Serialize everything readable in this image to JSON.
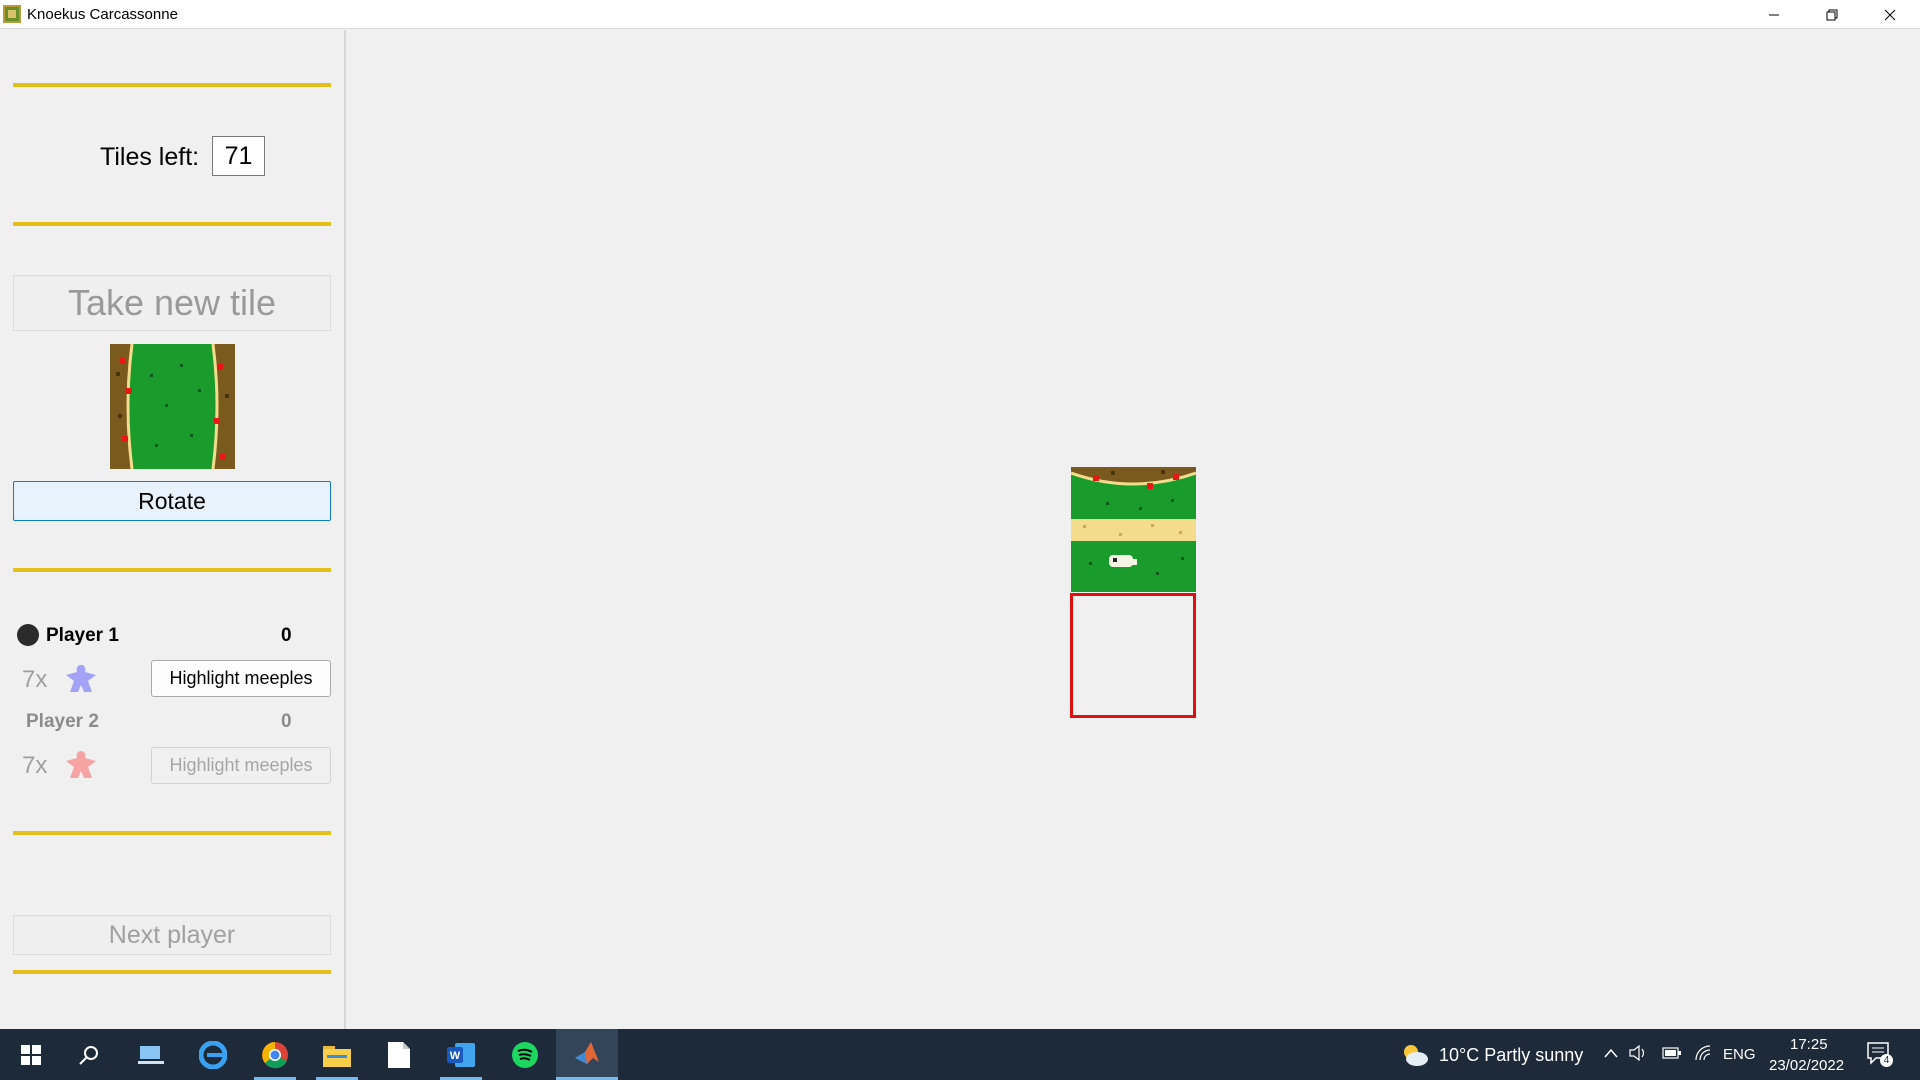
{
  "window": {
    "title": "Knoekus Carcassonne"
  },
  "sidebar": {
    "tiles_left_label": "Tiles left:",
    "tiles_left_value": "71",
    "take_tile_label": "Take new tile",
    "rotate_label": "Rotate",
    "next_player_label": "Next player",
    "players": [
      {
        "name": "Player 1",
        "score": "0",
        "meeples": "7x",
        "highlight_label": "Highlight meeples",
        "meeple_color": "#a3a3f5",
        "active": true
      },
      {
        "name": "Player 2",
        "score": "0",
        "meeples": "7x",
        "highlight_label": "Highlight meeples",
        "meeple_color": "#f5a3a3",
        "active": false
      }
    ]
  },
  "colors": {
    "divider": "#e6c01a",
    "grass": "#1a9c2c",
    "city": "#7a5a1e",
    "road": "#f3dc8c",
    "slot_border": "#e01010",
    "taskbar": "#1c2a3a"
  },
  "taskbar": {
    "icons": [
      "windows-start-icon",
      "search-icon",
      "task-view-icon",
      "edge-icon",
      "chrome-icon",
      "file-explorer-icon",
      "notepad-icon",
      "word-icon",
      "spotify-icon",
      "matlab-icon"
    ],
    "weather": "10°C  Partly sunny",
    "language": "ENG",
    "time": "17:25",
    "date": "23/02/2022",
    "notifications": "4"
  }
}
